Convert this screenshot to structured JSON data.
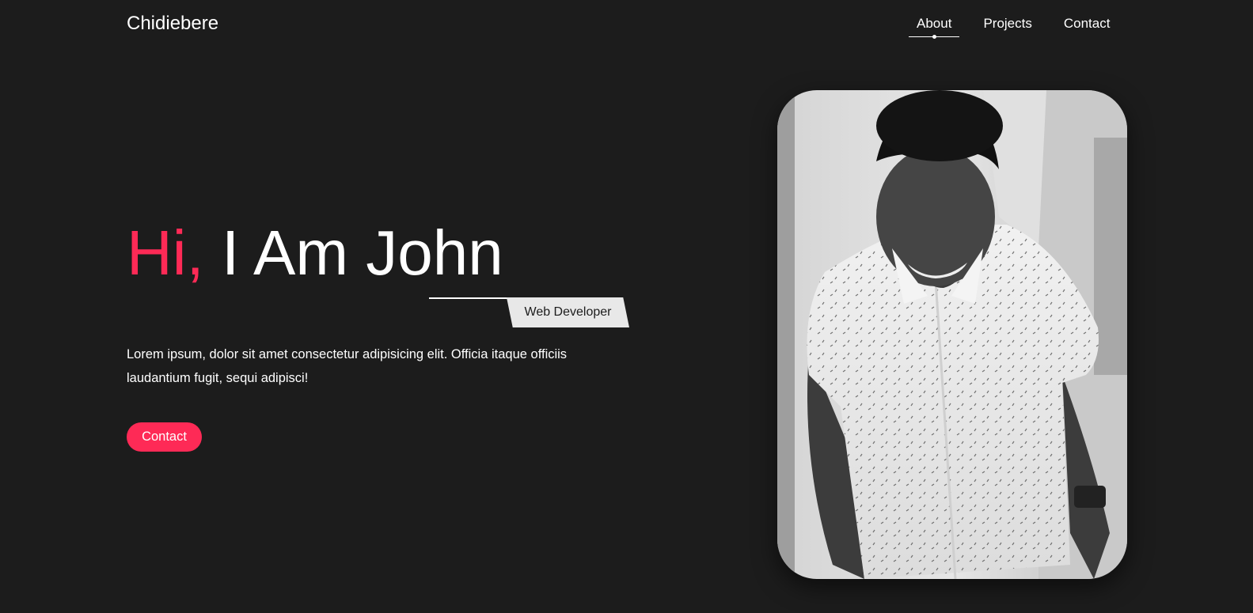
{
  "header": {
    "logo": "Chidiebere",
    "nav": [
      {
        "label": "About",
        "active": true
      },
      {
        "label": "Projects",
        "active": false
      },
      {
        "label": "Contact",
        "active": false
      }
    ]
  },
  "hero": {
    "greeting": "Hi,",
    "name": " I Am John",
    "role": "Web Developer",
    "description": "Lorem ipsum, dolor sit amet consectetur adipisicing elit. Officia itaque officiis laudantium fugit, sequi adipisci!",
    "cta_label": "Contact"
  },
  "photo": {
    "subject": "portrait-photo",
    "style": "black-and-white"
  },
  "colors": {
    "background": "#1c1c1c",
    "accent": "#fe2a56",
    "text": "#ffffff",
    "tag_bg": "#e8e8e8"
  }
}
